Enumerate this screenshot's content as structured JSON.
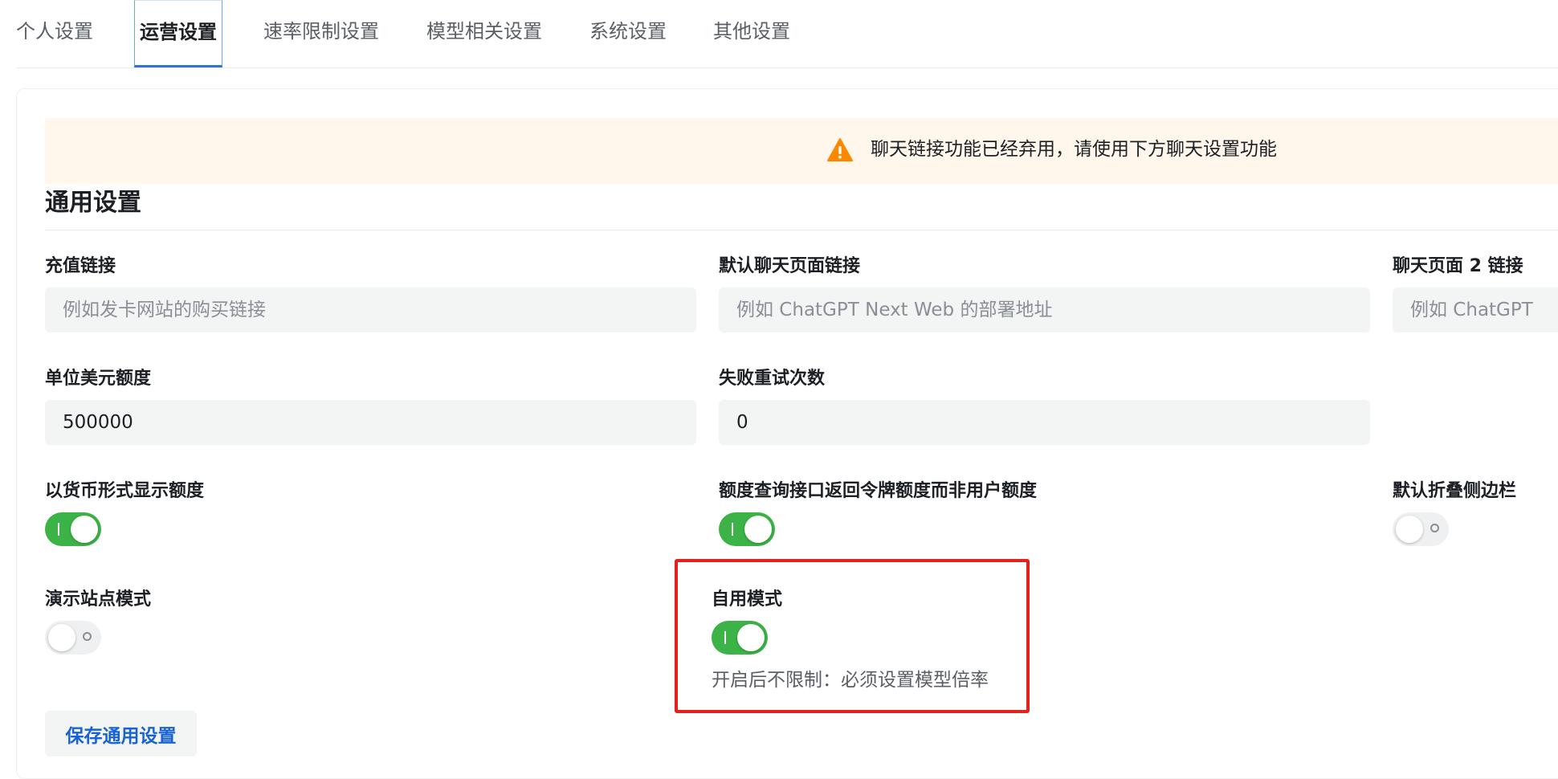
{
  "tabs": [
    {
      "label": "个人设置",
      "active": false
    },
    {
      "label": "运营设置",
      "active": true
    },
    {
      "label": "速率限制设置",
      "active": false
    },
    {
      "label": "模型相关设置",
      "active": false
    },
    {
      "label": "系统设置",
      "active": false
    },
    {
      "label": "其他设置",
      "active": false
    }
  ],
  "banner": {
    "icon": "warning-icon",
    "text": "聊天链接功能已经弃用，请使用下方聊天设置功能",
    "background_color": "#fff7ec",
    "icon_color": "#fc8800"
  },
  "general": {
    "title": "通用设置",
    "fields": {
      "topup_link": {
        "label": "充值链接",
        "value": "",
        "placeholder": "例如发卡网站的购买链接"
      },
      "default_chat_link": {
        "label": "默认聊天页面链接",
        "value": "",
        "placeholder": "例如 ChatGPT Next Web 的部署地址"
      },
      "chat_page2_link": {
        "label": "聊天页面 2 链接",
        "value": "",
        "placeholder": "例如 ChatGPT Next Web 的部署地址"
      },
      "quota_per_unit": {
        "label": "单位美元额度",
        "value": "500000",
        "placeholder": ""
      },
      "retry_times": {
        "label": "失败重试次数",
        "value": "0",
        "placeholder": ""
      }
    },
    "switches": {
      "display_in_currency": {
        "label": "以货币形式显示额度",
        "on": true
      },
      "token_quota_query": {
        "label": "额度查询接口返回令牌额度而非用户额度",
        "on": true
      },
      "default_collapse_sidebar": {
        "label": "默认折叠侧边栏",
        "on": false
      },
      "demo_site_mode": {
        "label": "演示站点模式",
        "on": false
      },
      "self_use_mode": {
        "label": "自用模式",
        "on": true,
        "helper": "开启后不限制：必须设置模型倍率"
      }
    },
    "save_label": "保存通用设置"
  },
  "colors": {
    "switch_on": "#3bb346",
    "switch_off": "#eef0f1",
    "highlight": "#e5211d",
    "primary_text": "#1763d6",
    "active_tab_border": "#2d74d9"
  }
}
